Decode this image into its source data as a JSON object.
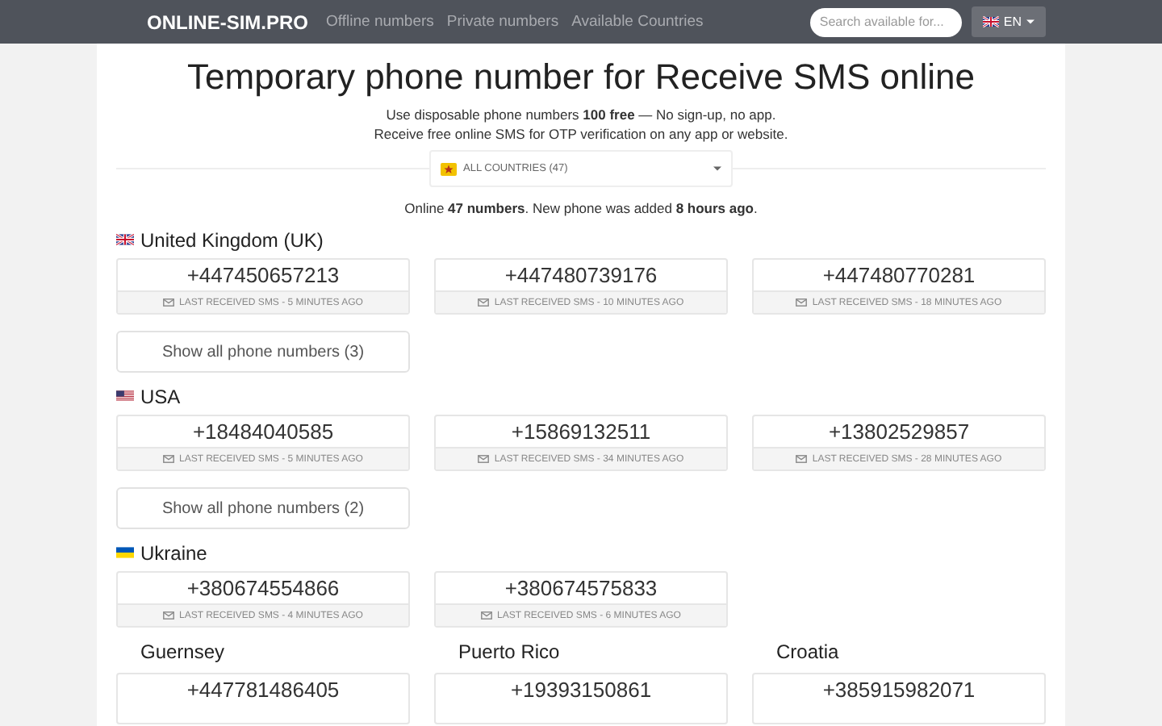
{
  "navbar": {
    "brand": "ONLINE-SIM.PRO",
    "links": [
      "Offline numbers",
      "Private numbers",
      "Available Countries"
    ],
    "search": {
      "placeholder": "Search available for..."
    },
    "language": {
      "flag": {
        "kind": "uk"
      },
      "label": "EN"
    }
  },
  "hero": {
    "title": "Temporary phone number for Receive SMS online",
    "subtitle": [
      "Use disposable phone numbers **100 free** — No sign-up, no app.",
      "Receive free online SMS for OTP verification on any app or website."
    ],
    "country_select": "ALL COUNTRIES (47)",
    "status": "Online **47 numbers**. New phone was added **8 hours ago**."
  },
  "groups": [
    {
      "country": "United Kingdom (UK)",
      "flag": {
        "kind": "uk"
      },
      "numbers": [
        {
          "number": "+447450657213",
          "last": "LAST RECEIVED SMS - 5 MINUTES AGO"
        },
        {
          "number": "+447480739176",
          "last": "LAST RECEIVED SMS - 10 MINUTES AGO"
        },
        {
          "number": "+447480770281",
          "last": "LAST RECEIVED SMS - 18 MINUTES AGO"
        }
      ],
      "show_all": "Show all phone numbers (3)"
    },
    {
      "country": "USA",
      "flag": {
        "kind": "us"
      },
      "numbers": [
        {
          "number": "+18484040585",
          "last": "LAST RECEIVED SMS - 5 MINUTES AGO"
        },
        {
          "number": "+15869132511",
          "last": "LAST RECEIVED SMS - 34 MINUTES AGO"
        },
        {
          "number": "+13802529857",
          "last": "LAST RECEIVED SMS - 28 MINUTES AGO"
        }
      ],
      "show_all": "Show all phone numbers (2)"
    },
    {
      "country": "Ukraine",
      "flag": {
        "kind": "ua"
      },
      "numbers": [
        {
          "number": "+380674554866",
          "last": "LAST RECEIVED SMS - 4 MINUTES AGO"
        },
        {
          "number": "+380674575833",
          "last": "LAST RECEIVED SMS - 6 MINUTES AGO"
        }
      ]
    }
  ],
  "singles": [
    {
      "country": "Guernsey",
      "number": "+447781486405"
    },
    {
      "country": "Puerto Rico",
      "number": "+19393150861"
    },
    {
      "country": "Croatia",
      "number": "+385915982071"
    }
  ]
}
